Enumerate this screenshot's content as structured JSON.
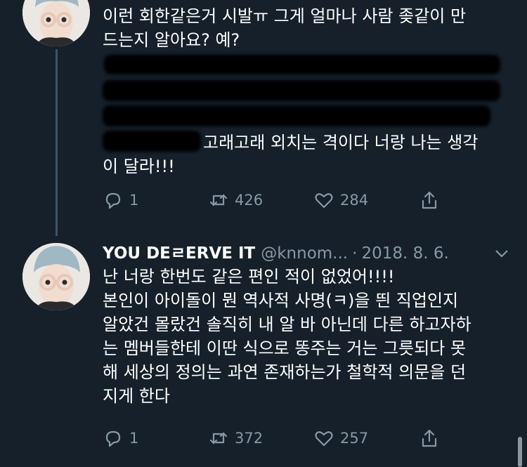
{
  "tweet1": {
    "text_top": "이런 회한같은거 시발ㅠ 그게 얼마나 사람 좆같이 만\n드는지 알아요? 예?",
    "text_tail_line1": "고래고래 외치는 격이다 너랑 나는 생각",
    "text_tail_line2": "이 달라!!!",
    "actions": {
      "reply_count": "1",
      "retweet_count": "426",
      "like_count": "284"
    }
  },
  "tweet2": {
    "display_name": "YOU DEㄹERVE IT",
    "handle": "@knnom...",
    "separator": "·",
    "date": "2018. 8. 6.",
    "text": "난 너랑 한번도 같은 편인 적이 없었어!!!!\n본인이 아이돌이 뭔 역사적 사명(ㅋ)을 띈 직업인지\n알았건 몰랐건 솔직히 내 알 바 아닌데 다른 하고자하\n는 멤버들한테 이딴 식으로 똥주는 거는 그릇되다 못\n해 세상의 정의는 과연 존재하는가 철학적 의문을 던\n지게 한다",
    "actions": {
      "reply_count": "1",
      "retweet_count": "372",
      "like_count": "257"
    }
  },
  "colors": {
    "background": "#15202b",
    "muted": "#8899a6",
    "text": "#ffffff",
    "thread_line": "#3d5466"
  },
  "icons": [
    "avatar",
    "reply-icon",
    "retweet-icon",
    "like-icon",
    "share-icon",
    "chevron-down-icon"
  ]
}
